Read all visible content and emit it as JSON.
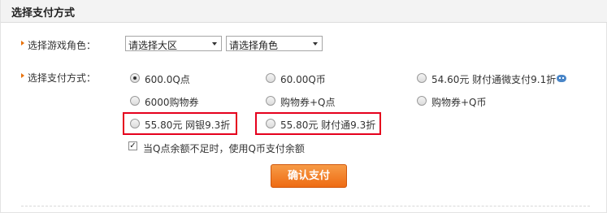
{
  "header": {
    "title": "选择支付方式"
  },
  "role_row": {
    "label": "选择游戏角色：",
    "region_select": "请选择大区",
    "role_select": "请选择角色"
  },
  "payment_row": {
    "label": "选择支付方式：",
    "options": [
      {
        "label": "600.0Q点",
        "selected": true
      },
      {
        "label": "60.00Q币",
        "selected": false
      },
      {
        "label": "54.60元 财付通微支付9.1折",
        "selected": false
      },
      {
        "label": "6000购物券",
        "selected": false
      },
      {
        "label": "购物券+Q点",
        "selected": false
      },
      {
        "label": "购物券+Q币",
        "selected": false
      },
      {
        "label": "55.80元 网银9.3折",
        "selected": false,
        "highlighted": true
      },
      {
        "label": "55.80元 财付通9.3折",
        "selected": false,
        "highlighted": true
      }
    ]
  },
  "balance_option": {
    "label": "当Q点余额不足时，使用Q币支付余额",
    "checked": true
  },
  "confirm_button": {
    "label": "确认支付"
  },
  "colors": {
    "accent": "#ee6b13",
    "highlight_border": "#e5001d",
    "arrow": "#e8720c"
  }
}
